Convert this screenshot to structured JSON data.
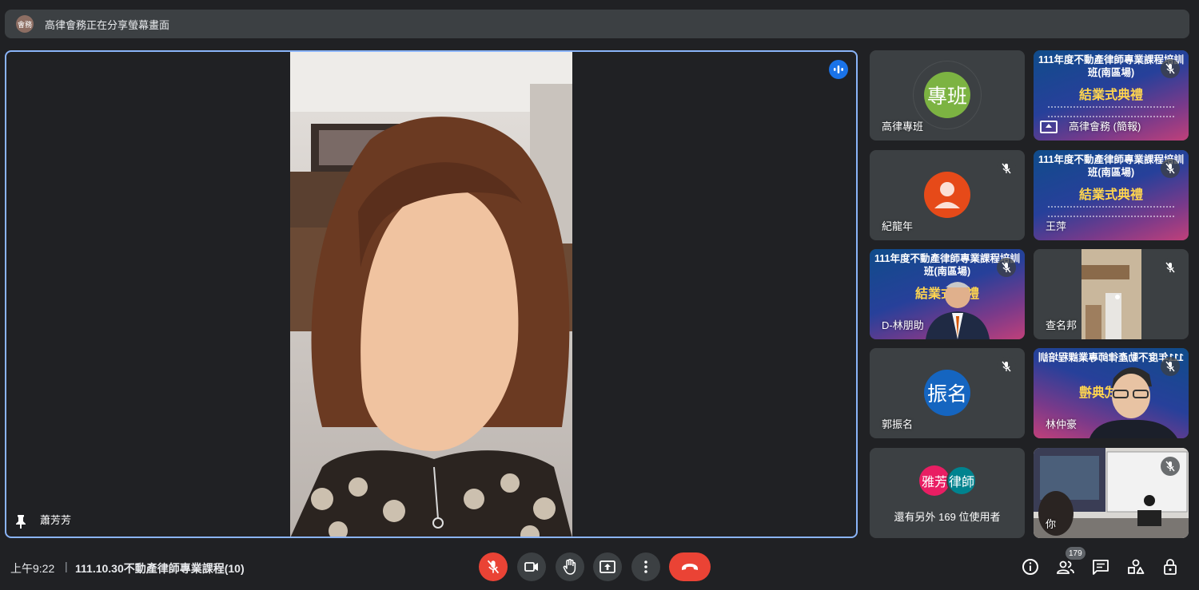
{
  "share_banner": {
    "badge": "會務",
    "text": "高律會務正在分享螢幕畫面"
  },
  "main": {
    "speaker_name": "蕭芳芳"
  },
  "slide": {
    "line1": "111年度不動產律師專業課程培訓",
    "line2": "班(南區場)",
    "line3": "結業式典禮"
  },
  "tiles": [
    {
      "name": "高律專班",
      "avatar_text": "專班",
      "avatar_color": "#7cb342"
    },
    {
      "name": "高律會務 (簡報)"
    },
    {
      "name": "紀龍年",
      "avatar_color": "#e64a19"
    },
    {
      "name": "王萍"
    },
    {
      "name": "D-林朋助"
    },
    {
      "name": "查名邦"
    },
    {
      "name": "郭振名",
      "avatar_text": "振名",
      "avatar_color": "#1565c0"
    },
    {
      "name": "林仲豪"
    },
    {
      "more_avatars": [
        "雅芳",
        "律師"
      ],
      "more_colors": [
        "#e91e63",
        "#00838f"
      ],
      "more_text": "還有另外 169 位使用者"
    },
    {
      "name": "你"
    }
  ],
  "bottom": {
    "time": "上午9:22",
    "separator": "|",
    "meeting_title": "111.10.30不動產律師專業課程(10)",
    "participant_count": "179"
  },
  "colors": {
    "accent": "#8ab4f8",
    "hangup": "#ea4335",
    "bg": "#202124",
    "tile": "#3c4043"
  }
}
